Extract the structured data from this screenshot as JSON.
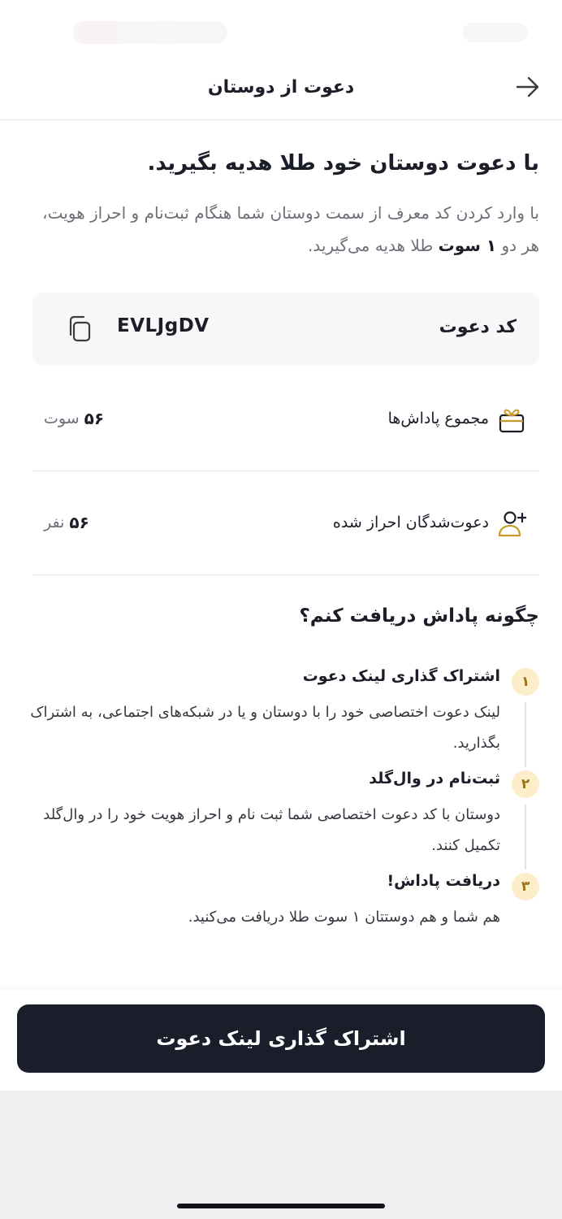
{
  "header": {
    "title": "دعوت از دوستان"
  },
  "intro": {
    "title": "با دعوت دوستان خود طلا هدیه بگیرید.",
    "desc_part1": "با وارد کردن کد معرف از سمت دوستان شما هنگام ثبت‌نام و احراز هویت، هر دو",
    "desc_bold": "۱ سوت",
    "desc_part2": "طلا هدیه می‌گیرید."
  },
  "invite_code": {
    "label": "کد دعوت",
    "value": "EVLJgDV"
  },
  "stats": {
    "rewards": {
      "label": "مجموع پاداش‌ها",
      "value": "۵۶",
      "unit": "سوت"
    },
    "invitees": {
      "label": "دعوت‌شدگان احراز شده",
      "value": "۵۶",
      "unit": "نفر"
    }
  },
  "how": {
    "title": "چگونه پاداش دریافت کنم؟",
    "steps": [
      {
        "num": "۱",
        "title": "اشتراک گذاری لینک دعوت",
        "desc": "لینک دعوت اختصاصی خود را با دوستان و یا در شبکه‌های اجتماعی، به اشتراک بگذارید."
      },
      {
        "num": "۲",
        "title": "ثبت‌نام در وال‌گلد",
        "desc": "دوستان با کد دعوت اختصاصی شما ثبت نام و احراز هویت خود را در وال‌گلد تکمیل کنند."
      },
      {
        "num": "۳",
        "title": "دریافت پاداش!",
        "desc": "هم شما و هم دوستتان ۱ سوت طلا دریافت می‌کنید."
      }
    ]
  },
  "footer": {
    "share_label": "اشتراک گذاری لینک دعوت"
  },
  "colors": {
    "accent": "#c89a2a",
    "primary_dark": "#1a1d2a",
    "step_badge_bg": "#fbeec9"
  }
}
